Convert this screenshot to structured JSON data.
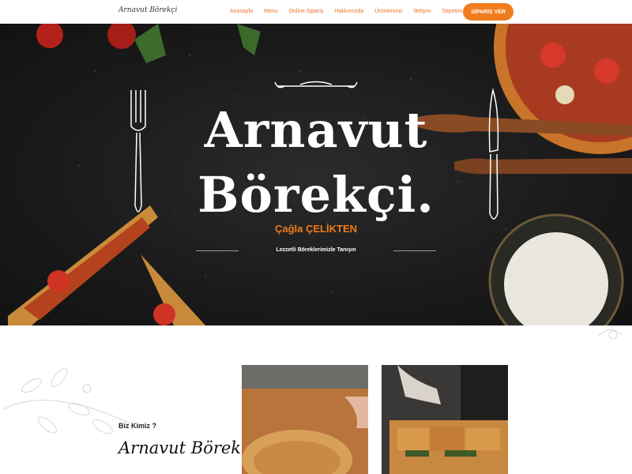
{
  "header": {
    "logo": "Arnavut Börekçi",
    "nav": [
      "Anasayfa",
      "Menu",
      "Online Sipariş",
      "Hakkımızda",
      "Ürünlerimiz",
      "İletişim",
      "Sepetim"
    ],
    "order_button": "SİPARİŞ VER",
    "accent": "#f07b1d"
  },
  "hero": {
    "title_line1": "Arnavut",
    "title_line2": "Börekçi.",
    "subtitle": "Çağla ÇELİKTEN",
    "tagline": "Lezzetli Böreklerimizle Tanışın"
  },
  "about": {
    "heading": "Biz Kimiz ?",
    "title": "Arnavut Börekçi"
  }
}
